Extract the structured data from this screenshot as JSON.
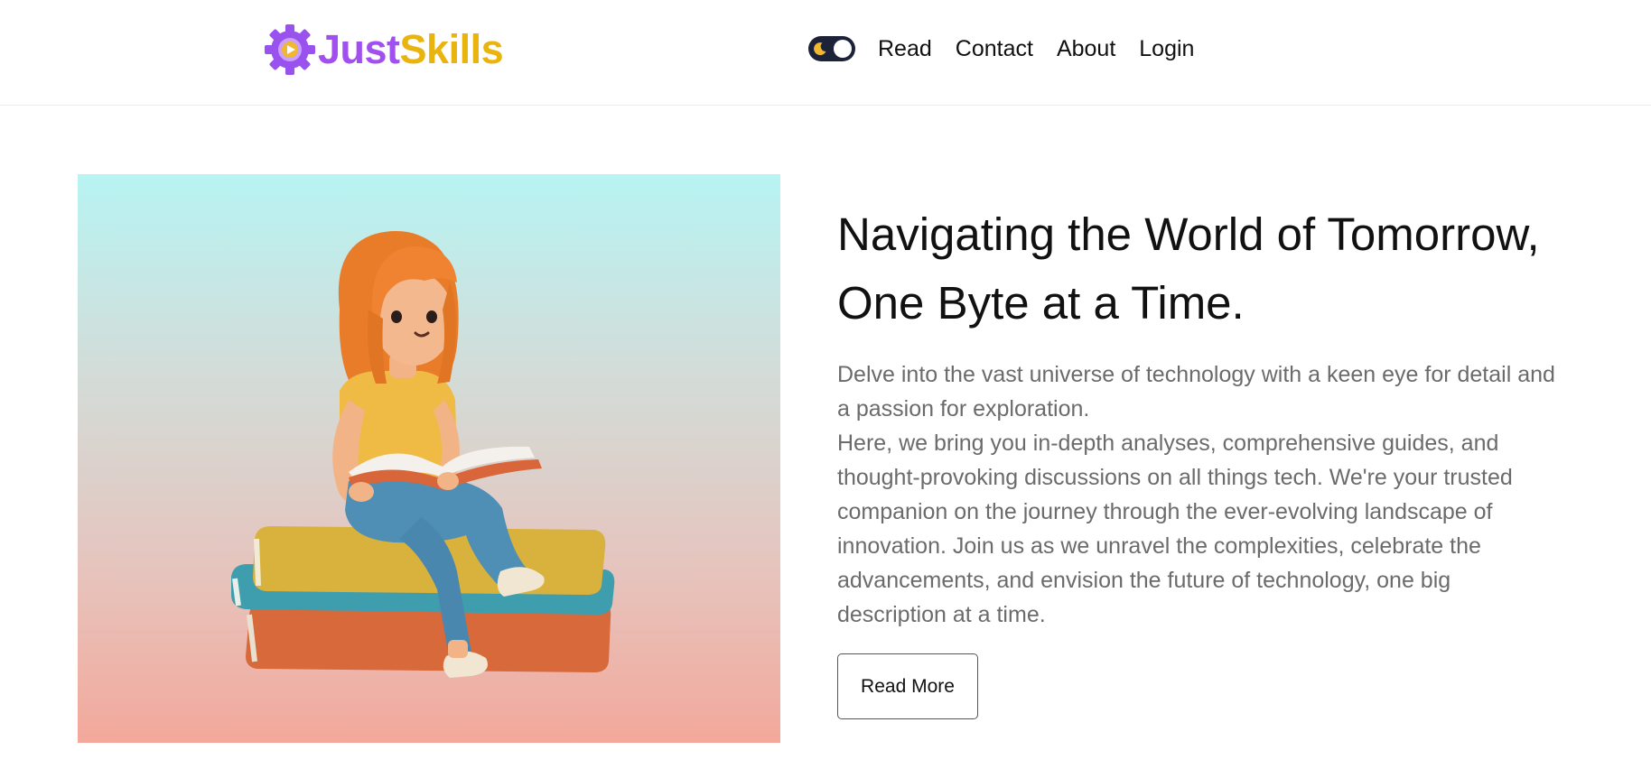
{
  "header": {
    "logo": {
      "part1": "Just",
      "part2": "Skills",
      "icon": "gear-play-icon"
    },
    "nav": {
      "theme_toggle": {
        "icon": "moon-icon",
        "state": "dark"
      },
      "links": [
        "Read",
        "Contact",
        "About",
        "Login"
      ]
    }
  },
  "hero": {
    "image": {
      "subject": "girl-reading-on-books-illustration"
    },
    "title": "Navigating the World of Tomorrow, One Byte at a Time.",
    "description": [
      "Delve into the vast universe of technology with a keen eye for detail and a passion for exploration.",
      "Here, we bring you in-depth analyses, comprehensive guides, and thought-provoking discussions on all things tech. We're your trusted companion on the journey through the ever-evolving landscape of innovation. Join us as we unravel the complexities, celebrate the advancements, and envision the future of technology, one big description at a time."
    ],
    "cta_label": "Read More"
  },
  "colors": {
    "brand_purple": "#a24ff0",
    "brand_yellow": "#eab40f",
    "toggle_dark": "#1c2237",
    "body_text": "#6b6b6b"
  }
}
